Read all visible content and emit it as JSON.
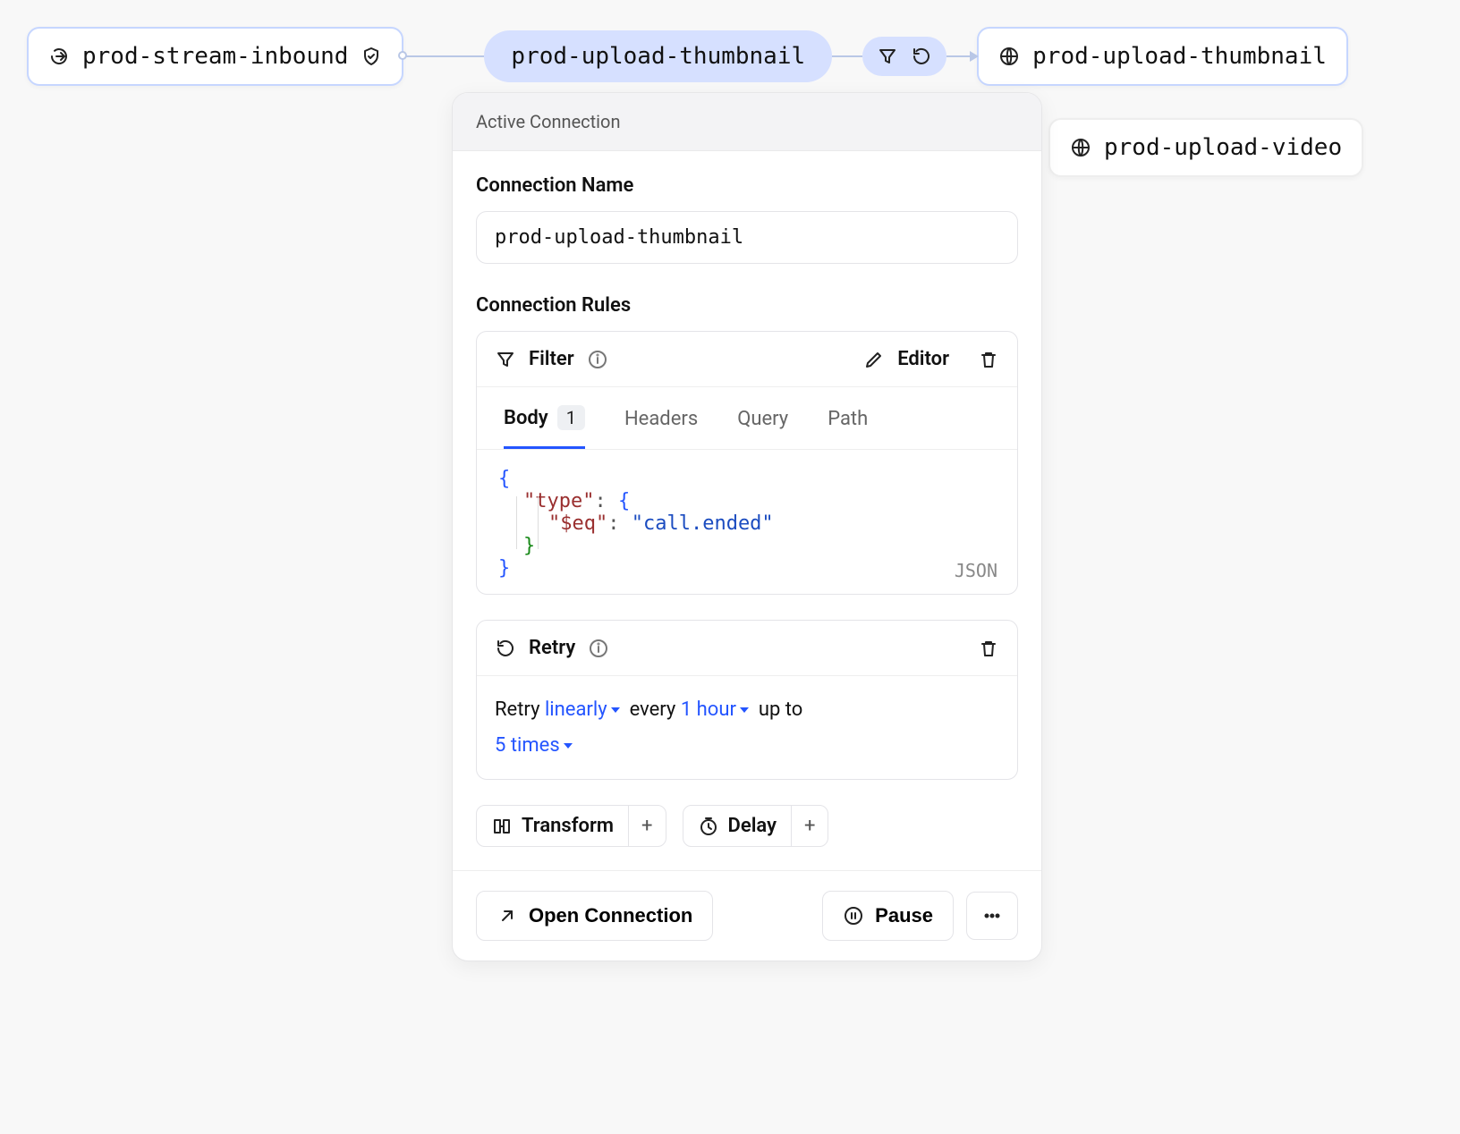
{
  "flow": {
    "source": {
      "label": "prod-stream-inbound"
    },
    "connection_pill": {
      "label": "prod-upload-thumbnail"
    },
    "targets": [
      {
        "label": "prod-upload-thumbnail"
      },
      {
        "label": "prod-upload-video"
      }
    ]
  },
  "panel": {
    "header_title": "Active Connection",
    "name_label": "Connection Name",
    "name_value": "prod-upload-thumbnail",
    "rules_label": "Connection Rules",
    "filter": {
      "title": "Filter",
      "editor_label": "Editor",
      "tabs": {
        "body": "Body",
        "body_count": "1",
        "headers": "Headers",
        "query": "Query",
        "path": "Path"
      },
      "code": {
        "k_type": "\"type\"",
        "k_eq": "\"$eq\"",
        "v_eq": "\"call.ended\"",
        "lang_badge": "JSON"
      }
    },
    "retry": {
      "title": "Retry",
      "text_retry": "Retry",
      "opt_linearly": "linearly",
      "text_every": "every",
      "opt_interval": "1 hour",
      "text_upto": "up to",
      "opt_times": "5 times"
    },
    "chips": {
      "transform": "Transform",
      "delay": "Delay"
    },
    "footer": {
      "open": "Open Connection",
      "pause": "Pause"
    }
  }
}
